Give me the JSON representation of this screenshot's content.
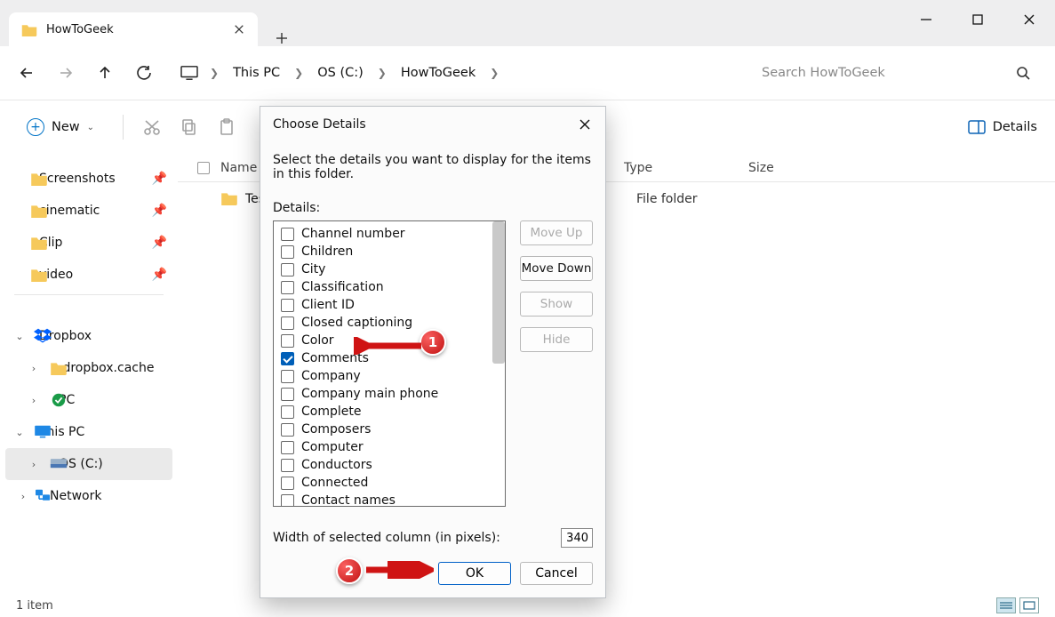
{
  "tab": {
    "title": "HowToGeek"
  },
  "breadcrumb": {
    "segments": [
      "This PC",
      "OS (C:)",
      "HowToGeek"
    ]
  },
  "search": {
    "placeholder": "Search HowToGeek"
  },
  "toolbar": {
    "new_label": "New",
    "details_label": "Details"
  },
  "columns": {
    "name": "Name",
    "type": "Type",
    "size": "Size"
  },
  "sidebar": {
    "quick": [
      {
        "label": "Screenshots",
        "pinned": true
      },
      {
        "label": "cinematic",
        "pinned": true
      },
      {
        "label": "Clip",
        "pinned": true
      },
      {
        "label": "video",
        "pinned": true
      }
    ],
    "dropbox": {
      "label": "Dropbox",
      "children": [
        ".dropbox.cache",
        "PC"
      ]
    },
    "thispc": {
      "label": "This PC",
      "children": [
        "OS (C:)"
      ]
    },
    "network": {
      "label": "Network"
    }
  },
  "rows": [
    {
      "name": "Test",
      "type": "File folder"
    }
  ],
  "status": {
    "item_count": "1 item"
  },
  "dialog": {
    "title": "Choose Details",
    "instruction": "Select the details you want to display for the items in this folder.",
    "section_label": "Details:",
    "items": [
      {
        "label": "Channel number",
        "checked": false
      },
      {
        "label": "Children",
        "checked": false
      },
      {
        "label": "City",
        "checked": false
      },
      {
        "label": "Classification",
        "checked": false
      },
      {
        "label": "Client ID",
        "checked": false
      },
      {
        "label": "Closed captioning",
        "checked": false
      },
      {
        "label": "Color",
        "checked": false
      },
      {
        "label": "Comments",
        "checked": true
      },
      {
        "label": "Company",
        "checked": false
      },
      {
        "label": "Company main phone",
        "checked": false
      },
      {
        "label": "Complete",
        "checked": false
      },
      {
        "label": "Composers",
        "checked": false
      },
      {
        "label": "Computer",
        "checked": false
      },
      {
        "label": "Conductors",
        "checked": false
      },
      {
        "label": "Connected",
        "checked": false
      },
      {
        "label": "Contact names",
        "checked": false
      }
    ],
    "buttons": {
      "move_up": "Move Up",
      "move_down": "Move Down",
      "show": "Show",
      "hide": "Hide"
    },
    "width_label": "Width of selected column (in pixels):",
    "width_value": "340",
    "ok": "OK",
    "cancel": "Cancel"
  },
  "annotations": {
    "b1": "1",
    "b2": "2"
  }
}
